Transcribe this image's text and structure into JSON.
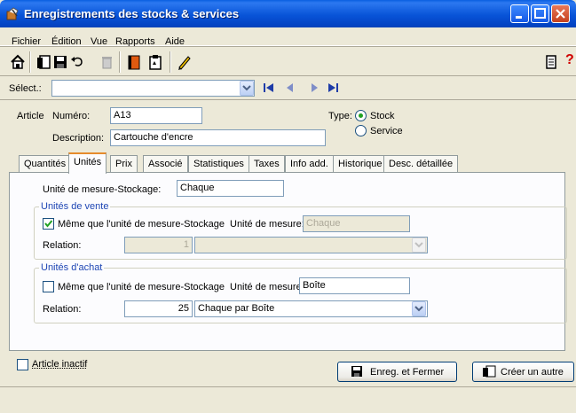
{
  "window": {
    "title": "Enregistrements des stocks & services",
    "icon": "app-stock-icon"
  },
  "menu": [
    "Fichier",
    "Édition",
    "Vue",
    "Rapports",
    "Aide"
  ],
  "toolbar": {
    "icons": [
      "home-icon",
      "new-record-icon",
      "save-icon",
      "undo-icon",
      "trash-icon",
      "book-icon",
      "clipboard-icon",
      "pencil-icon",
      "report-icon",
      "help-icon"
    ],
    "help_glyph": "?"
  },
  "select_row": {
    "label": "Sélect.:",
    "value": ""
  },
  "article": {
    "label": "Article",
    "numero_label": "Numéro:",
    "numero_value": "A13",
    "description_label": "Description:",
    "description_value": "Cartouche d'encre",
    "type_label": "Type:",
    "type_options": [
      "Stock",
      "Service"
    ],
    "type_selected": "Stock"
  },
  "tabs": [
    "Quantités",
    "Unités",
    "Prix",
    "Associé",
    "Statistiques",
    "Taxes",
    "Info add.",
    "Historique",
    "Desc. détaillée"
  ],
  "active_tab": "Unités",
  "units": {
    "stockage_label": "Unité de mesure-Stockage:",
    "stockage_value": "Chaque",
    "vente": {
      "title": "Unités de vente",
      "same_label": "Même que l'unité de mesure-Stockage",
      "same_checked": true,
      "unit_label": "Unité de mesure:",
      "unit_value": "Chaque",
      "relation_label": "Relation:",
      "relation_value": "1",
      "relation_unit": ""
    },
    "achat": {
      "title": "Unités d'achat",
      "same_label": "Même que l'unité de mesure-Stockage",
      "same_checked": false,
      "unit_label": "Unité de mesure:",
      "unit_value": "Boîte",
      "relation_label": "Relation:",
      "relation_value": "25",
      "relation_unit": "Chaque par Boîte"
    }
  },
  "footer": {
    "inactive_label": "Article inactif",
    "inactive_checked": false,
    "save_close_label": "Enreg. et Fermer",
    "create_other_label": "Créer un autre"
  }
}
